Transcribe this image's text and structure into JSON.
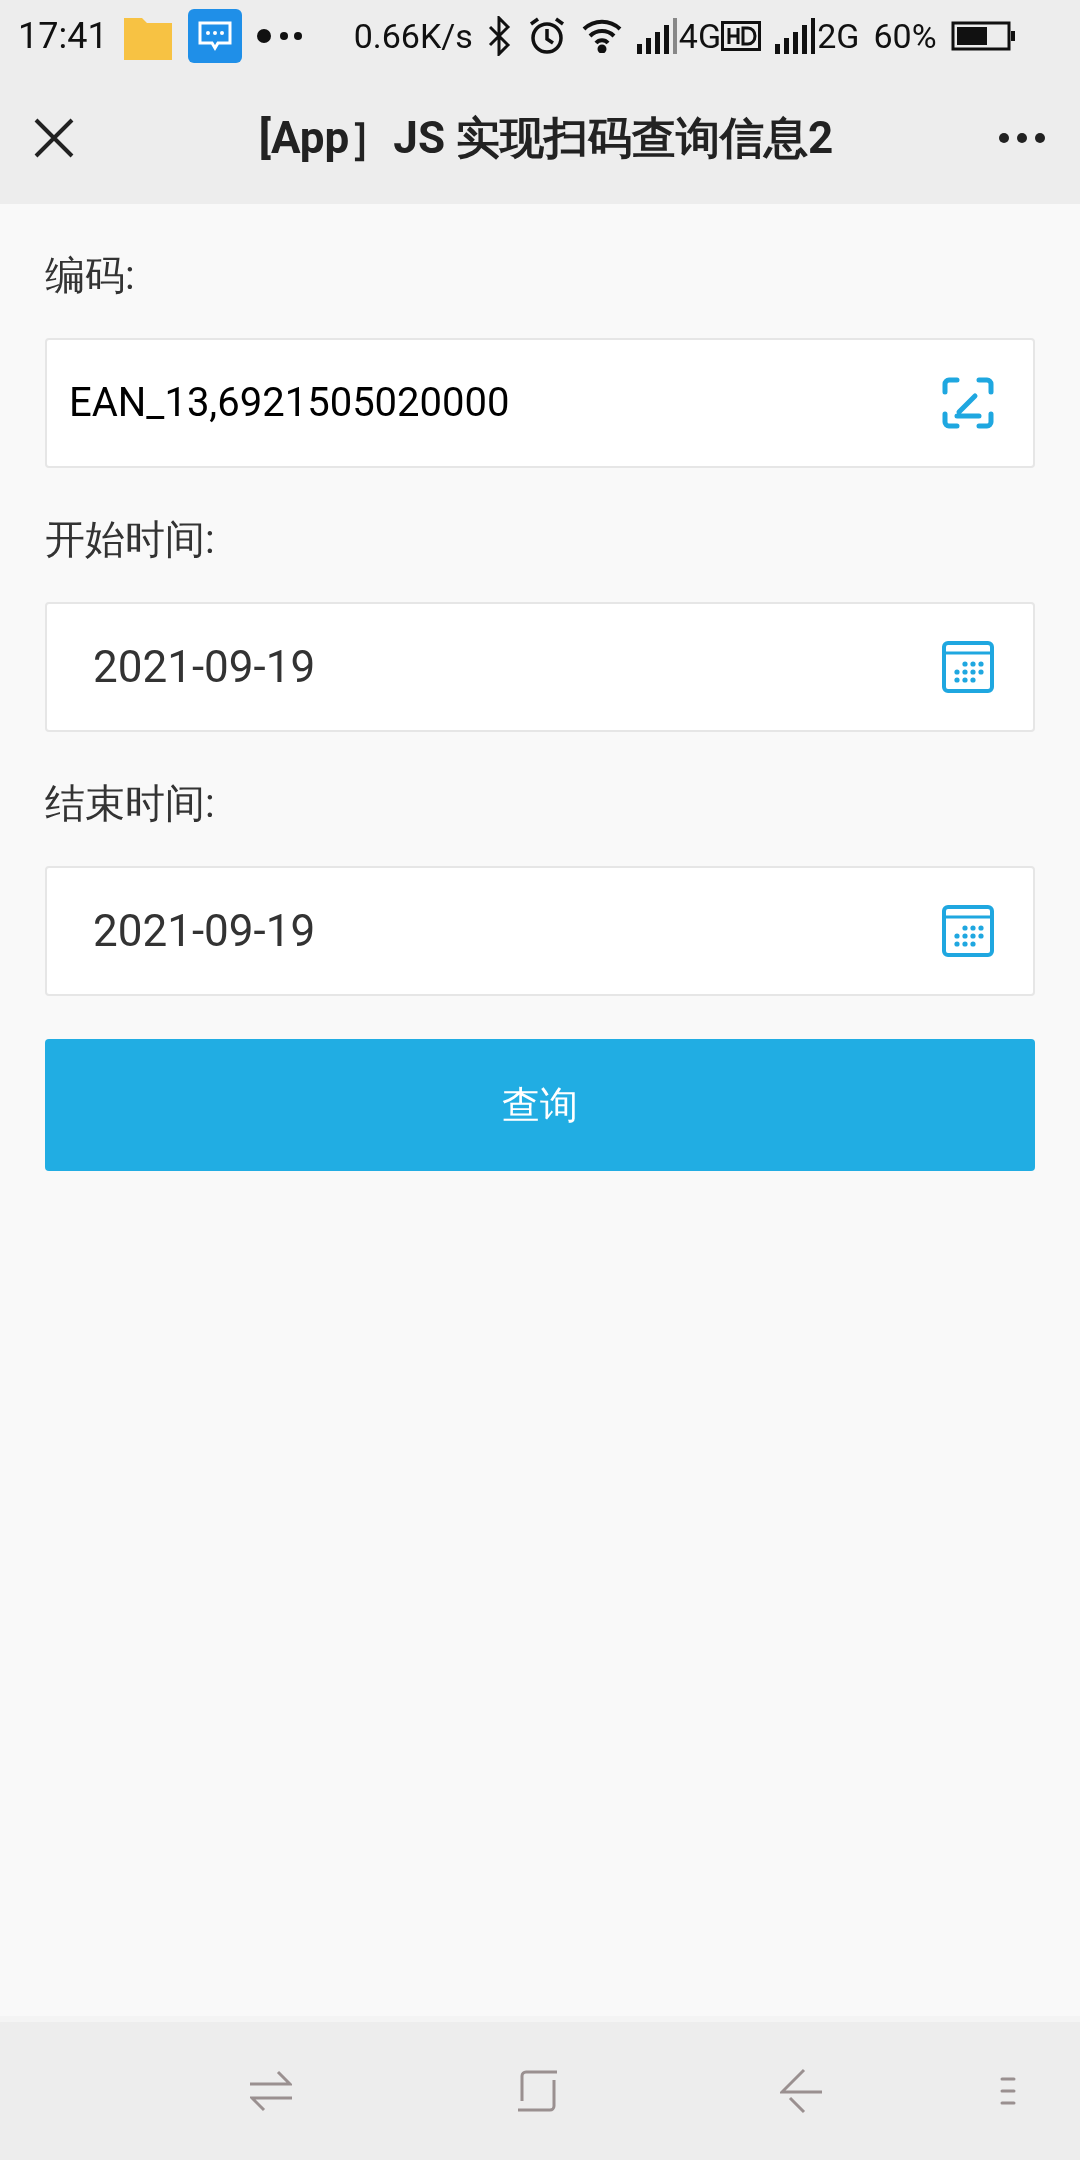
{
  "status_bar": {
    "time": "17:41",
    "speed": "0.66K/s",
    "network_1": "4G",
    "network_2": "2G",
    "battery": "60%"
  },
  "nav": {
    "title": "[App］JS 实现扫码查询信息2"
  },
  "form": {
    "fields": [
      {
        "label": "编码:",
        "value": "EAN_13,6921505020000",
        "kind": "scan"
      },
      {
        "label": "开始时间:",
        "value": "2021-09-19",
        "kind": "date"
      },
      {
        "label": "结束时间:",
        "value": "2021-09-19",
        "kind": "date"
      }
    ],
    "submit": "查询"
  }
}
